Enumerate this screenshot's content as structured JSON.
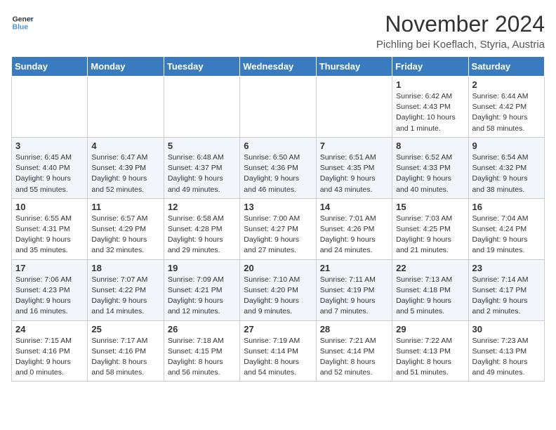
{
  "header": {
    "logo_line1": "General",
    "logo_line2": "Blue",
    "month_year": "November 2024",
    "location": "Pichling bei Koeflach, Styria, Austria"
  },
  "days_of_week": [
    "Sunday",
    "Monday",
    "Tuesday",
    "Wednesday",
    "Thursday",
    "Friday",
    "Saturday"
  ],
  "weeks": [
    [
      {
        "day": "",
        "info": ""
      },
      {
        "day": "",
        "info": ""
      },
      {
        "day": "",
        "info": ""
      },
      {
        "day": "",
        "info": ""
      },
      {
        "day": "",
        "info": ""
      },
      {
        "day": "1",
        "info": "Sunrise: 6:42 AM\nSunset: 4:43 PM\nDaylight: 10 hours\nand 1 minute."
      },
      {
        "day": "2",
        "info": "Sunrise: 6:44 AM\nSunset: 4:42 PM\nDaylight: 9 hours\nand 58 minutes."
      }
    ],
    [
      {
        "day": "3",
        "info": "Sunrise: 6:45 AM\nSunset: 4:40 PM\nDaylight: 9 hours\nand 55 minutes."
      },
      {
        "day": "4",
        "info": "Sunrise: 6:47 AM\nSunset: 4:39 PM\nDaylight: 9 hours\nand 52 minutes."
      },
      {
        "day": "5",
        "info": "Sunrise: 6:48 AM\nSunset: 4:37 PM\nDaylight: 9 hours\nand 49 minutes."
      },
      {
        "day": "6",
        "info": "Sunrise: 6:50 AM\nSunset: 4:36 PM\nDaylight: 9 hours\nand 46 minutes."
      },
      {
        "day": "7",
        "info": "Sunrise: 6:51 AM\nSunset: 4:35 PM\nDaylight: 9 hours\nand 43 minutes."
      },
      {
        "day": "8",
        "info": "Sunrise: 6:52 AM\nSunset: 4:33 PM\nDaylight: 9 hours\nand 40 minutes."
      },
      {
        "day": "9",
        "info": "Sunrise: 6:54 AM\nSunset: 4:32 PM\nDaylight: 9 hours\nand 38 minutes."
      }
    ],
    [
      {
        "day": "10",
        "info": "Sunrise: 6:55 AM\nSunset: 4:31 PM\nDaylight: 9 hours\nand 35 minutes."
      },
      {
        "day": "11",
        "info": "Sunrise: 6:57 AM\nSunset: 4:29 PM\nDaylight: 9 hours\nand 32 minutes."
      },
      {
        "day": "12",
        "info": "Sunrise: 6:58 AM\nSunset: 4:28 PM\nDaylight: 9 hours\nand 29 minutes."
      },
      {
        "day": "13",
        "info": "Sunrise: 7:00 AM\nSunset: 4:27 PM\nDaylight: 9 hours\nand 27 minutes."
      },
      {
        "day": "14",
        "info": "Sunrise: 7:01 AM\nSunset: 4:26 PM\nDaylight: 9 hours\nand 24 minutes."
      },
      {
        "day": "15",
        "info": "Sunrise: 7:03 AM\nSunset: 4:25 PM\nDaylight: 9 hours\nand 21 minutes."
      },
      {
        "day": "16",
        "info": "Sunrise: 7:04 AM\nSunset: 4:24 PM\nDaylight: 9 hours\nand 19 minutes."
      }
    ],
    [
      {
        "day": "17",
        "info": "Sunrise: 7:06 AM\nSunset: 4:23 PM\nDaylight: 9 hours\nand 16 minutes."
      },
      {
        "day": "18",
        "info": "Sunrise: 7:07 AM\nSunset: 4:22 PM\nDaylight: 9 hours\nand 14 minutes."
      },
      {
        "day": "19",
        "info": "Sunrise: 7:09 AM\nSunset: 4:21 PM\nDaylight: 9 hours\nand 12 minutes."
      },
      {
        "day": "20",
        "info": "Sunrise: 7:10 AM\nSunset: 4:20 PM\nDaylight: 9 hours\nand 9 minutes."
      },
      {
        "day": "21",
        "info": "Sunrise: 7:11 AM\nSunset: 4:19 PM\nDaylight: 9 hours\nand 7 minutes."
      },
      {
        "day": "22",
        "info": "Sunrise: 7:13 AM\nSunset: 4:18 PM\nDaylight: 9 hours\nand 5 minutes."
      },
      {
        "day": "23",
        "info": "Sunrise: 7:14 AM\nSunset: 4:17 PM\nDaylight: 9 hours\nand 2 minutes."
      }
    ],
    [
      {
        "day": "24",
        "info": "Sunrise: 7:15 AM\nSunset: 4:16 PM\nDaylight: 9 hours\nand 0 minutes."
      },
      {
        "day": "25",
        "info": "Sunrise: 7:17 AM\nSunset: 4:16 PM\nDaylight: 8 hours\nand 58 minutes."
      },
      {
        "day": "26",
        "info": "Sunrise: 7:18 AM\nSunset: 4:15 PM\nDaylight: 8 hours\nand 56 minutes."
      },
      {
        "day": "27",
        "info": "Sunrise: 7:19 AM\nSunset: 4:14 PM\nDaylight: 8 hours\nand 54 minutes."
      },
      {
        "day": "28",
        "info": "Sunrise: 7:21 AM\nSunset: 4:14 PM\nDaylight: 8 hours\nand 52 minutes."
      },
      {
        "day": "29",
        "info": "Sunrise: 7:22 AM\nSunset: 4:13 PM\nDaylight: 8 hours\nand 51 minutes."
      },
      {
        "day": "30",
        "info": "Sunrise: 7:23 AM\nSunset: 4:13 PM\nDaylight: 8 hours\nand 49 minutes."
      }
    ]
  ]
}
